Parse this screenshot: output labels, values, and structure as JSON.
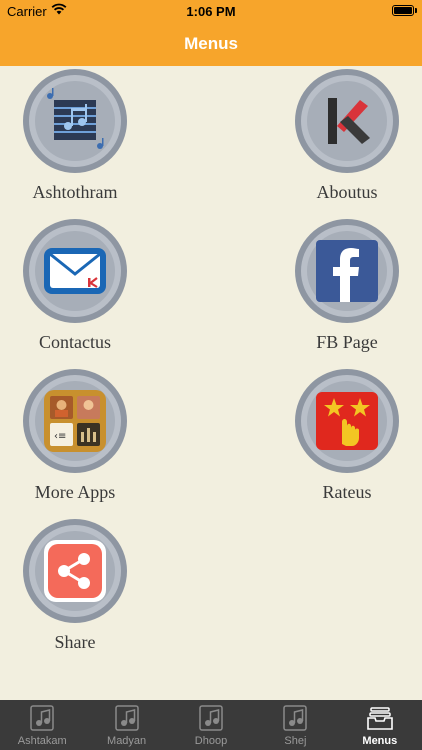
{
  "status_bar": {
    "carrier": "Carrier",
    "time": "1:06 PM"
  },
  "nav": {
    "title": "Menus"
  },
  "menu_items": [
    {
      "label": "Ashtothram",
      "icon": "music-notes-icon"
    },
    {
      "label": "Aboutus",
      "icon": "k-logo-icon"
    },
    {
      "label": "Contactus",
      "icon": "mail-icon"
    },
    {
      "label": "FB Page",
      "icon": "facebook-icon"
    },
    {
      "label": "More Apps",
      "icon": "more-apps-icon"
    },
    {
      "label": "Rateus",
      "icon": "rate-us-icon"
    },
    {
      "label": "Share",
      "icon": "share-icon"
    }
  ],
  "tabs": [
    {
      "label": "Ashtakam",
      "icon": "music-note-icon",
      "active": false
    },
    {
      "label": "Madyan",
      "icon": "music-note-icon",
      "active": false
    },
    {
      "label": "Dhoop",
      "icon": "music-note-icon",
      "active": false
    },
    {
      "label": "Shej",
      "icon": "music-note-icon",
      "active": false
    },
    {
      "label": "Menus",
      "icon": "inbox-tray-icon",
      "active": true
    }
  ],
  "colors": {
    "accent": "#f7a52b",
    "background": "#f2efdf",
    "tab_bar": "#3a3a3a"
  }
}
